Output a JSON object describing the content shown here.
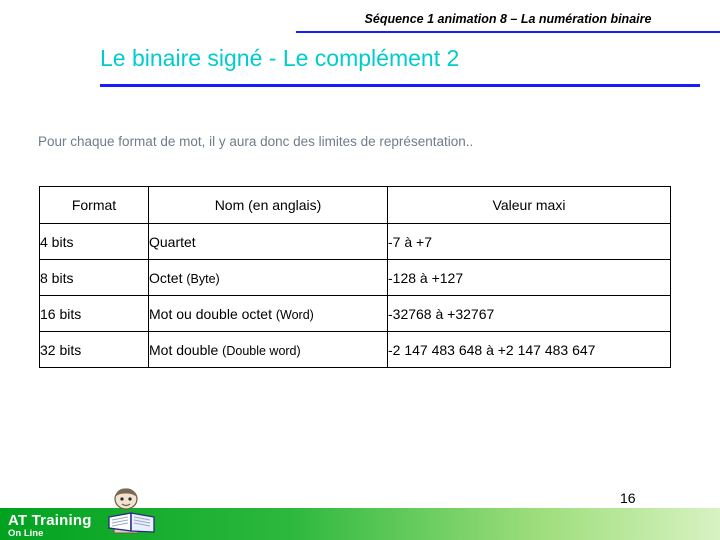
{
  "header": {
    "breadcrumb": "Séquence 1 animation 8 – La numération binaire",
    "title": "Le binaire signé - Le complément  2"
  },
  "content": {
    "intro": "Pour chaque format de mot, il y aura donc des limites de représentation..",
    "table": {
      "columns": [
        "Format",
        "Nom (en anglais)",
        "Valeur maxi"
      ],
      "rows": [
        {
          "format": "4 bits",
          "name": "Quartet",
          "name_suffix": "",
          "value": "-7 à +7"
        },
        {
          "format": "8 bits",
          "name": "Octet ",
          "name_suffix": "(Byte)",
          "value": "-128 à +127"
        },
        {
          "format": "16 bits",
          "name": "Mot ou double octet ",
          "name_suffix": "(Word)",
          "value": "-32768 à +32767"
        },
        {
          "format": "32 bits",
          "name": "Mot double ",
          "name_suffix": "(Double word)",
          "value": "-2 147 483 648 à +2 147 483 647"
        }
      ]
    }
  },
  "footer": {
    "page_number": "16",
    "brand": "AT Training",
    "brand_sub": "On Line",
    "logo_icon": "book-character-logo"
  },
  "colors": {
    "rule": "#1a1aff",
    "title": "#00cccc",
    "intro_text": "#6e7c8c",
    "footer_gradient_start": "#00a21f",
    "footer_gradient_end": "#d8f2c2"
  }
}
